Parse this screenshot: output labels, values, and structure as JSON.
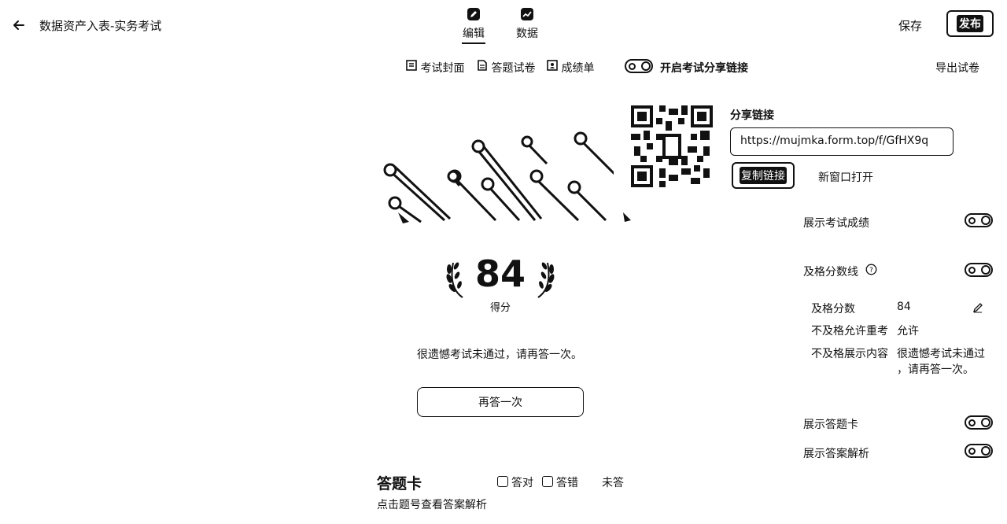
{
  "header": {
    "title": "数据资产入表-实务考试",
    "tabs": [
      {
        "label": "编辑"
      },
      {
        "label": "数据"
      }
    ],
    "save_label": "保存",
    "publish_label": "发布"
  },
  "subnav": {
    "items": [
      {
        "label": "考试封面"
      },
      {
        "label": "答题试卷"
      },
      {
        "label": "成绩单"
      }
    ],
    "share_toggle_label": "开启考试分享链接",
    "export_label": "导出试卷"
  },
  "share": {
    "title": "分享链接",
    "url": "https://mujmka.form.top/f/GfHX9q",
    "copy_label": "复制链接",
    "open_label": "新窗口打开"
  },
  "result": {
    "score": "84",
    "score_label": "得分",
    "message": "很遗憾考试未通过，请再答一次。",
    "retry_label": "再答一次"
  },
  "answer_card": {
    "title": "答题卡",
    "hint": "点击题号查看答案解析",
    "legend": [
      {
        "label": "答对"
      },
      {
        "label": "答错"
      },
      {
        "label": "未答"
      }
    ]
  },
  "settings": {
    "show_score_label": "展示考试成绩",
    "pass_line_label": "及格分数线",
    "pass_score_key": "及格分数",
    "pass_score_value": "84",
    "retake_key": "不及格允许重考",
    "retake_value": "允许",
    "fail_content_key": "不及格展示内容",
    "fail_content_value_1": "很遗憾考试未通过",
    "fail_content_value_2": "，请再答一次。",
    "show_card_label": "展示答题卡",
    "show_analysis_label": "展示答案解析"
  }
}
